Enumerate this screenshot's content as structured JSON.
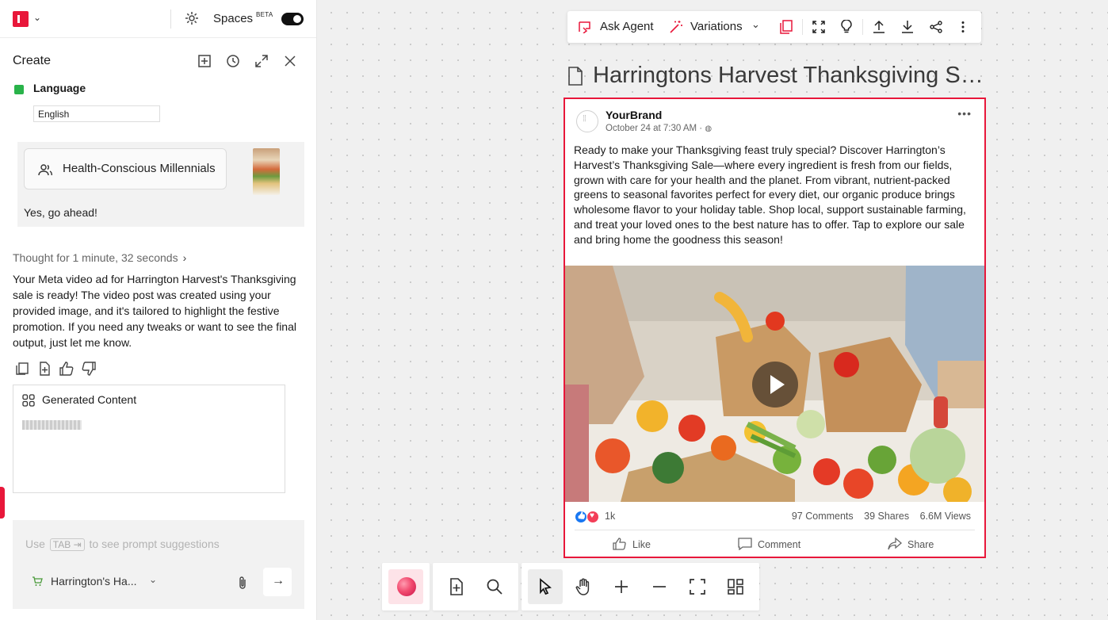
{
  "left_panel": {
    "spaces_label": "Spaces",
    "beta_label": "BETA",
    "create_title": "Create",
    "language_heading": "Language",
    "language_value": "English",
    "audience_chip": "Health-Conscious Millennials",
    "user_message": "Yes, go ahead!",
    "thought_label": "Thought for 1 minute, 32 seconds",
    "assistant_reply": "Your Meta video ad for Harrington Harvest's Thanksgiving sale is ready! The video post was created using your provided image, and it's tailored to highlight the festive promotion. If you need any tweaks or want to see the final output, just let me know.",
    "generated_title": "Generated Content",
    "prompt_prefix": "Use",
    "prompt_key": "TAB ⇥",
    "prompt_suffix": "to see prompt suggestions",
    "brand_selector": "Harrington's Ha..."
  },
  "toolbar": {
    "ask_agent": "Ask Agent",
    "variations": "Variations"
  },
  "document": {
    "title": "Harringtons Harvest Thanksgiving Sale"
  },
  "post": {
    "brand": "YourBrand",
    "date": "October 24 at 7:30 AM",
    "body": "Ready to make your Thanksgiving feast truly special? Discover Harrington’s Harvest’s Thanksgiving Sale—where every ingredient is fresh from our fields, grown with care for your health and the planet. From vibrant, nutrient-packed greens to seasonal favorites perfect for every diet, our organic produce brings wholesome flavor to your holiday table. Shop local, support sustainable farming, and treat your loved ones to the best nature has to offer. Tap to explore our sale and bring home the goodness this season!",
    "reactions": "1k",
    "comments": "97 Comments",
    "shares": "39 Shares",
    "views": "6.6M Views",
    "like_label": "Like",
    "comment_label": "Comment",
    "share_label": "Share"
  },
  "colors": {
    "accent": "#e8173a",
    "like_blue": "#1877f2",
    "love_red": "#f33e58",
    "check_green": "#29b34a"
  }
}
